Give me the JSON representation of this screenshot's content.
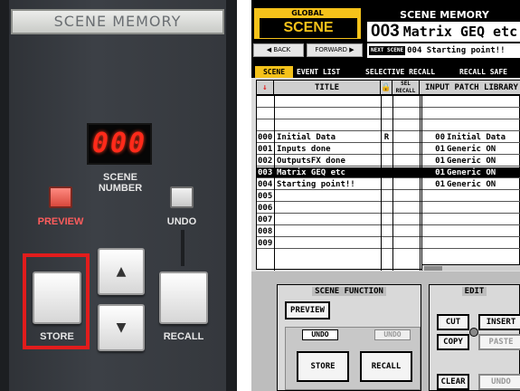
{
  "hardware": {
    "title": "SCENE MEMORY",
    "display_value": "000",
    "scene_number_label": "SCENE\nNUMBER",
    "preview_label": "PREVIEW",
    "undo_label": "UNDO",
    "store_label": "STORE",
    "recall_label": "RECALL",
    "up_glyph": "▲",
    "down_glyph": "▼"
  },
  "lcd": {
    "global_label": "GLOBAL",
    "global_scene": "SCENE",
    "back_label": "◀ BACK",
    "forward_label": "FORWARD ▶",
    "title": "SCENE MEMORY",
    "current_number": "003",
    "current_name": "Matrix GEQ etc",
    "next_tag": "NEXT SCENE",
    "next_text": "004 Starting point!!",
    "tabs": {
      "scene": "SCENE",
      "event_list": "EVENT LIST",
      "selective_recall": "SELECTIVE RECALL",
      "recall_safe": "RECALL SAFE"
    },
    "list_header": {
      "arrow": "↓",
      "title": "TITLE",
      "lock": "🔒",
      "sel_recall": "SEL RECALL",
      "input_patch": "INPUT PATCH LIBRARY"
    },
    "rows": [
      {
        "num": "",
        "title": "",
        "lock": "",
        "sel": "",
        "pnum": "",
        "pname": ""
      },
      {
        "num": "",
        "title": "",
        "lock": "",
        "sel": "",
        "pnum": "",
        "pname": ""
      },
      {
        "num": "",
        "title": "",
        "lock": "",
        "sel": "",
        "pnum": "",
        "pname": ""
      },
      {
        "num": "000",
        "title": "Initial Data",
        "lock": "R",
        "sel": "",
        "pnum": "00",
        "pname": "Initial Data"
      },
      {
        "num": "001",
        "title": "Inputs done",
        "lock": "",
        "sel": "",
        "pnum": "01",
        "pname": "Generic ON"
      },
      {
        "num": "002",
        "title": "OutputsFX done",
        "lock": "",
        "sel": "",
        "pnum": "01",
        "pname": "Generic ON"
      },
      {
        "num": "003",
        "title": "Matrix GEQ etc",
        "lock": "",
        "sel": "",
        "pnum": "01",
        "pname": "Generic ON"
      },
      {
        "num": "004",
        "title": "Starting point!!",
        "lock": "",
        "sel": "",
        "pnum": "01",
        "pname": "Generic ON"
      },
      {
        "num": "005",
        "title": "",
        "lock": "",
        "sel": "",
        "pnum": "",
        "pname": ""
      },
      {
        "num": "006",
        "title": "",
        "lock": "",
        "sel": "",
        "pnum": "",
        "pname": ""
      },
      {
        "num": "007",
        "title": "",
        "lock": "",
        "sel": "",
        "pnum": "",
        "pname": ""
      },
      {
        "num": "008",
        "title": "",
        "lock": "",
        "sel": "",
        "pnum": "",
        "pname": ""
      },
      {
        "num": "009",
        "title": "",
        "lock": "",
        "sel": "",
        "pnum": "",
        "pname": ""
      }
    ],
    "selected_row_index": 6,
    "scene_function": {
      "title": "SCENE FUNCTION",
      "preview": "PREVIEW",
      "undo_store": "UNDO",
      "undo_recall": "UNDO",
      "store": "STORE",
      "recall": "RECALL"
    },
    "edit": {
      "title": "EDIT",
      "cut": "CUT",
      "copy": "COPY",
      "insert": "INSERT",
      "paste": "PASTE",
      "clear": "CLEAR",
      "undo": "UNDO"
    }
  },
  "colors": {
    "accent_yellow": "#f5c21a",
    "led_red": "#ff2a1a",
    "highlight_red": "#e21c1c"
  }
}
